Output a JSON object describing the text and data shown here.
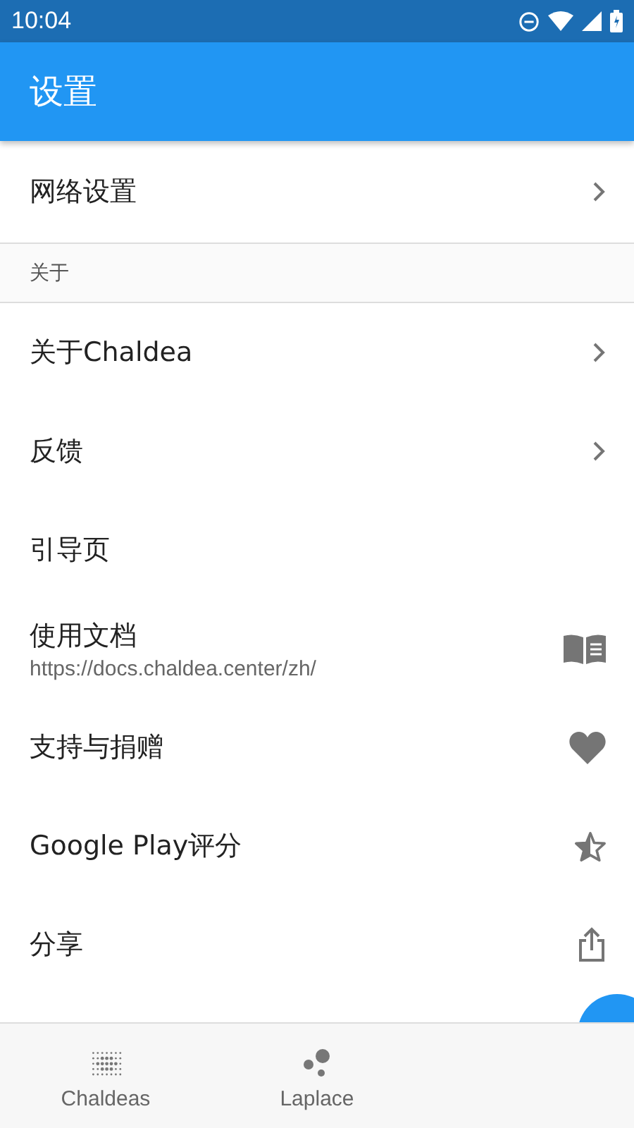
{
  "status_bar": {
    "time": "10:04"
  },
  "app_bar": {
    "title": "设置"
  },
  "sections": [
    {
      "items": [
        {
          "kind": "chevron",
          "title": "网络设置"
        }
      ]
    },
    {
      "header": "关于",
      "items": [
        {
          "kind": "chevron",
          "title": "关于Chaldea"
        },
        {
          "kind": "chevron",
          "title": "反馈"
        },
        {
          "kind": "plain",
          "title": "引导页"
        },
        {
          "kind": "icon",
          "title": "使用文档",
          "subtitle": "https://docs.chaldea.center/zh/"
        },
        {
          "kind": "icon",
          "title": "支持与捐赠"
        },
        {
          "kind": "icon",
          "title": "Google Play评分"
        },
        {
          "kind": "icon",
          "title": "分享"
        }
      ]
    }
  ],
  "bottom_nav": [
    {
      "label": "Chaldeas"
    },
    {
      "label": "Laplace"
    }
  ]
}
